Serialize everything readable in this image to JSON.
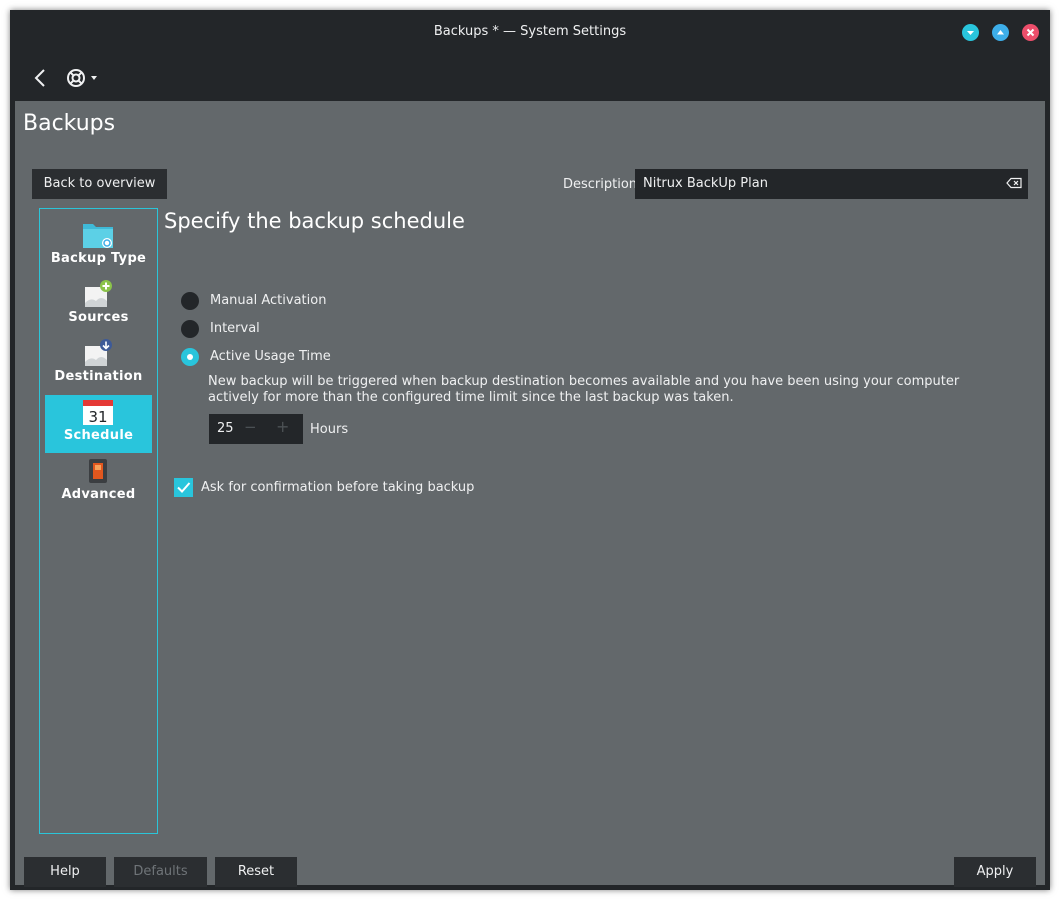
{
  "window": {
    "title": "Backups * — System Settings"
  },
  "page": {
    "title": "Backups"
  },
  "header": {
    "back_button": "Back to overview",
    "description_label": "Description:",
    "description_value": "Nitrux BackUp Plan"
  },
  "sidebar": {
    "items": [
      {
        "label": "Backup Type",
        "icon": "folder-sync-icon"
      },
      {
        "label": "Sources",
        "icon": "drive-add-icon"
      },
      {
        "label": "Destination",
        "icon": "drive-download-icon"
      },
      {
        "label": "Schedule",
        "icon": "calendar-icon",
        "active": true
      },
      {
        "label": "Advanced",
        "icon": "switch-icon"
      }
    ]
  },
  "schedule": {
    "heading": "Specify the backup schedule",
    "options": [
      {
        "label": "Manual Activation",
        "checked": false
      },
      {
        "label": "Interval",
        "checked": false
      },
      {
        "label": "Active Usage Time",
        "checked": true
      }
    ],
    "explanation": "New backup will be triggered when backup destination becomes available and you have been using your computer actively for more than the configured time limit since the last backup was taken.",
    "spin_value": "25",
    "spin_minus": "−",
    "spin_plus": "+",
    "spin_unit": "Hours",
    "confirm_label": "Ask for confirmation before taking backup",
    "confirm_checked": true
  },
  "footer": {
    "help": "Help",
    "defaults": "Defaults",
    "reset": "Reset",
    "apply": "Apply"
  },
  "colors": {
    "accent": "#29c5dc",
    "window_bg": "#232629",
    "content_bg": "#63686b",
    "button_bg": "#2b2e31",
    "close": "#ed4e6b",
    "maximize": "#3daee9",
    "minimize": "#29c5dc"
  }
}
